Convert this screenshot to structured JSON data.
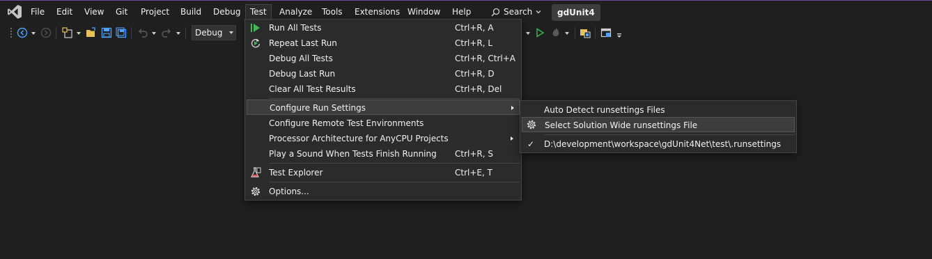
{
  "menubar": {
    "items": [
      "File",
      "Edit",
      "View",
      "Git",
      "Project",
      "Build",
      "Debug",
      "Test",
      "Analyze",
      "Tools",
      "Extensions",
      "Window",
      "Help"
    ],
    "search_label": "Search",
    "solution_name": "gdUnit4"
  },
  "toolbar": {
    "configuration": "Debug"
  },
  "test_menu": {
    "items": [
      {
        "label": "Run All Tests",
        "shortcut": "Ctrl+R, A",
        "icon": "run-all-icon"
      },
      {
        "label": "Repeat Last Run",
        "shortcut": "Ctrl+R, L",
        "icon": "repeat-icon"
      },
      {
        "label": "Debug All Tests",
        "shortcut": "Ctrl+R, Ctrl+A"
      },
      {
        "label": "Debug Last Run",
        "shortcut": "Ctrl+R, D"
      },
      {
        "label": "Clear All Test Results",
        "shortcut": "Ctrl+R, Del"
      },
      {
        "label": "Configure Run Settings",
        "submenu": true
      },
      {
        "label": "Configure Remote Test Environments"
      },
      {
        "label": "Processor Architecture for AnyCPU Projects",
        "submenu": true
      },
      {
        "label": "Play a Sound When Tests Finish Running",
        "shortcut": "Ctrl+R, S"
      },
      {
        "label": "Test Explorer",
        "shortcut": "Ctrl+E, T",
        "icon": "test-explorer-icon"
      },
      {
        "label": "Options...",
        "icon": "gear-icon"
      }
    ]
  },
  "runsettings_submenu": {
    "items": [
      {
        "label": "Auto Detect runsettings Files"
      },
      {
        "label": "Select Solution Wide runsettings File",
        "icon": "gear-icon"
      },
      {
        "label": "D:\\development\\workspace\\gdUnit4Net\\test\\.runsettings",
        "checked": true,
        "check_glyph": "✓"
      }
    ]
  },
  "colors": {
    "background": "#1f1f1f",
    "menu_background": "#2b2b2b",
    "highlight": "#3d3d3d",
    "accent_purple": "#6a4c9c",
    "run_green": "#3fb950",
    "icon_blue": "#4da3ff"
  }
}
